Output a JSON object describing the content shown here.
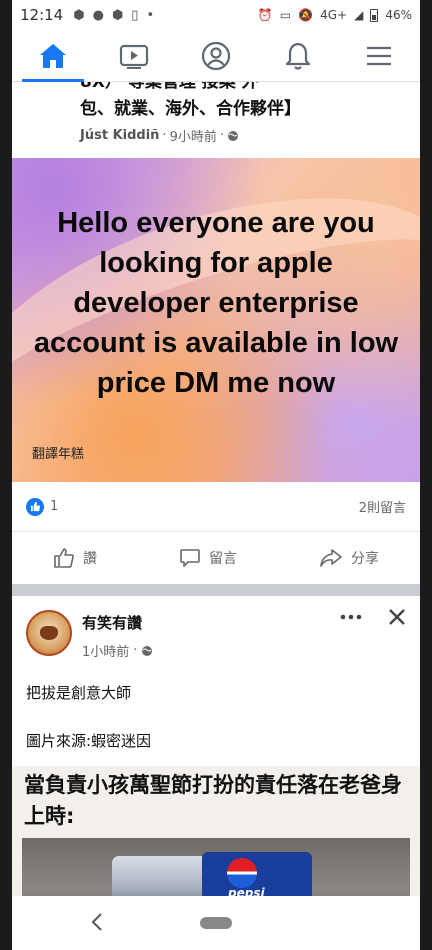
{
  "status_bar": {
    "time": "12:14",
    "network": "4G+",
    "battery": "46%"
  },
  "nav": {
    "items": [
      {
        "name": "home",
        "icon": "home-icon",
        "active": true
      },
      {
        "name": "watch",
        "icon": "video-icon",
        "active": false
      },
      {
        "name": "profile",
        "icon": "profile-icon",
        "active": false
      },
      {
        "name": "notifications",
        "icon": "bell-icon",
        "active": false
      },
      {
        "name": "menu",
        "icon": "menu-icon",
        "active": false
      }
    ]
  },
  "post1": {
    "text_cut_line": "8X）    等業管理    接案    外",
    "text_line2": "包、就業、海外、合作夥伴】",
    "author": "Júst Kiddiñ",
    "time": "9小時前",
    "card_text": "Hello everyone are you looking for apple developer enterprise account is available in low price DM me now",
    "translate_label": "翻譯年糕",
    "like_count": "1",
    "comment_count": "2則留言",
    "actions": {
      "like": "讚",
      "comment": "留言",
      "share": "分享"
    }
  },
  "post2": {
    "page_name": "有笑有讚",
    "time": "1小時前",
    "body_line1": "把拔是創意大師",
    "body_line2": "圖片來源:蝦密迷因",
    "meme_title": "當負責小孩萬聖節打扮的責任落在老爸身上時:",
    "meme_brand": "pepsi"
  },
  "colors": {
    "accent": "#1877f2",
    "muted_text": "#65676b"
  }
}
